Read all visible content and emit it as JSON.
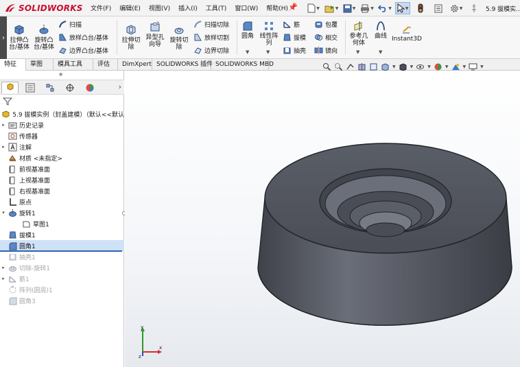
{
  "app": {
    "logo_text": "SOLIDWORKS",
    "document_title": "5.9 拔模实..."
  },
  "menu": [
    "文件(F)",
    "编辑(E)",
    "视图(V)",
    "插入(I)",
    "工具(T)",
    "窗口(W)",
    "帮助(H)"
  ],
  "colors": {
    "accent": "#c8102e",
    "selection": "#cfe1f7",
    "rollback": "#2f63b4",
    "model": "#4b4e57"
  },
  "ribbon": {
    "extrude_boss": "拉伸凸\n台/基体",
    "revolve_boss": "旋转凸\n台/基体",
    "sweep": "扫描",
    "loft_boss": "放样凸台/基体",
    "boundary_boss": "边界凸台/基体",
    "extrude_cut": "拉伸切\n除",
    "hole_wizard": "异型孔\n向导",
    "revolve_cut": "旋转切\n除",
    "sweep_cut": "扫描切除",
    "loft_cut": "放样切割",
    "boundary_cut": "边界切除",
    "fillet": "圆角",
    "linear_pattern": "线性阵\n列",
    "rib": "筋",
    "draft": "拔模",
    "shell": "抽壳",
    "wrap": "包覆",
    "intersect": "相交",
    "mirror": "镜向",
    "reference_geometry": "参考几\n何体",
    "curves": "曲线",
    "instant3d": "Instant3D"
  },
  "tabs": [
    "特征",
    "草图",
    "模具工具",
    "评估",
    "DimXpert",
    "SOLIDWORKS 插件",
    "SOLIDWORKS MBD"
  ],
  "tree": {
    "root": "5.9 拔模实例（封盖建模）（默认<<默认",
    "items": [
      "历史记录",
      "传感器",
      "注解",
      "材质 <未指定>",
      "前视基准面",
      "上视基准面",
      "右视基准面",
      "原点",
      "旋转1",
      "草图1",
      "拔模1",
      "圆角1",
      "抽壳1",
      "切除-旋转1",
      "筋1",
      "阵列(圆周)1",
      "圆角3"
    ]
  },
  "icons": [
    "search-icon",
    "filter-icon",
    "pin-icon",
    "gear-icon",
    "arrow-select-icon"
  ]
}
